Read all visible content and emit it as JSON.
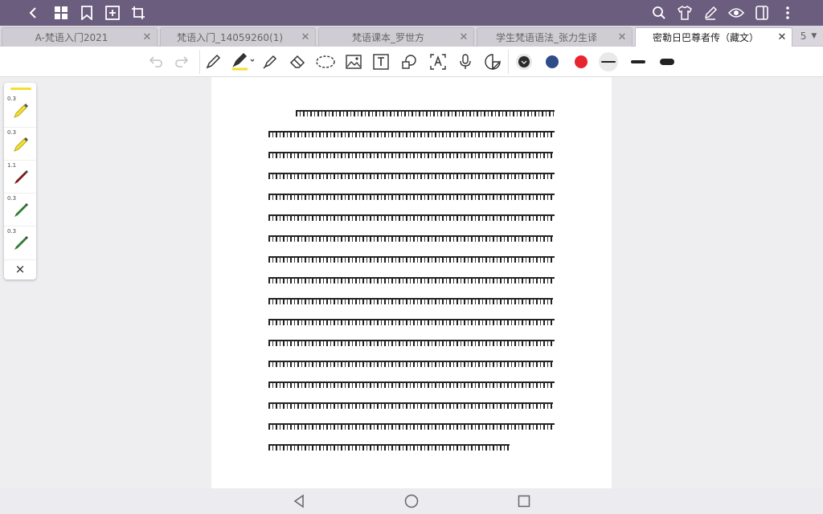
{
  "topbar": {
    "icons": [
      "back-icon",
      "grid-icon",
      "bookmark-icon",
      "add-page-icon",
      "crop-icon",
      "search-icon",
      "shirt-icon",
      "pen-edit-icon",
      "eye-icon",
      "sidebar-icon",
      "more-icon"
    ]
  },
  "tabs": [
    {
      "label": "A-梵语入门2021",
      "active": false
    },
    {
      "label": "梵语入门_14059260(1)",
      "active": false
    },
    {
      "label": "梵语课本_罗世方",
      "active": false
    },
    {
      "label": "学生梵语语法_张力生译",
      "active": false
    },
    {
      "label": "密勒日巴尊者传（藏文）",
      "active": true
    }
  ],
  "tab_count": "5",
  "toolbar": {
    "tools": [
      "undo-icon",
      "redo-icon",
      "pen-icon",
      "highlighter-icon",
      "marker-icon",
      "eraser-icon",
      "lasso-icon",
      "image-icon",
      "textbox-icon",
      "shape-icon",
      "ocr-icon",
      "microphone-icon",
      "sticker-icon"
    ],
    "colors": [
      "#2b2b2b",
      "#2f4b8a",
      "#e8242f"
    ],
    "stroke_widths": [
      "thin",
      "medium",
      "thick"
    ]
  },
  "pens": [
    {
      "width": "0.3",
      "color": "#f2e030",
      "kind": "highlighter"
    },
    {
      "width": "0.3",
      "color": "#f2e030",
      "kind": "highlighter"
    },
    {
      "width": "1.1",
      "color": "#7a1a1a",
      "kind": "pen"
    },
    {
      "width": "0.3",
      "color": "#2e7d32",
      "kind": "pen"
    },
    {
      "width": "0.3",
      "color": "#2e7d32",
      "kind": "pen"
    }
  ],
  "pens_close": "×",
  "document": {
    "line_count": 17
  }
}
